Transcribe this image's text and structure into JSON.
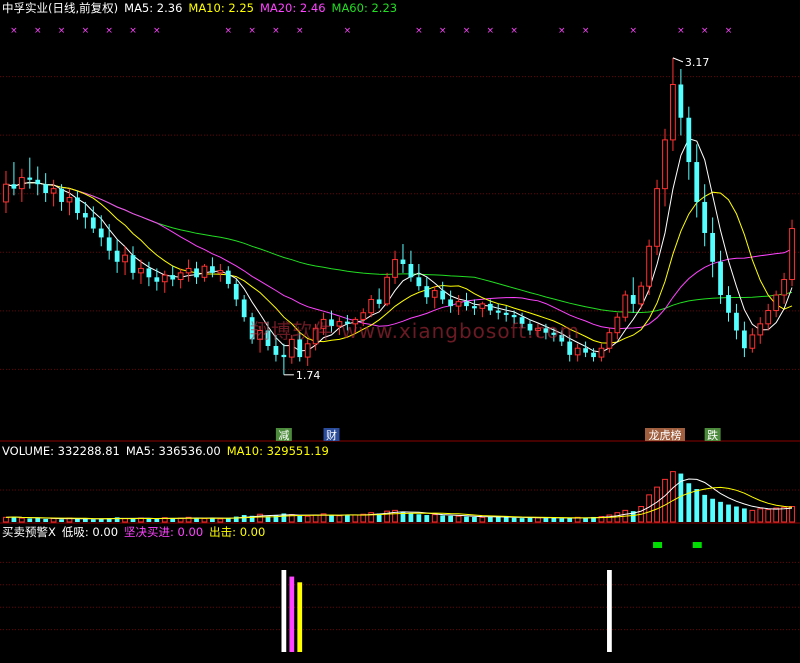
{
  "colors": {
    "up": "#ff3232",
    "down": "#54ffff",
    "ma5": "#ffffff",
    "ma10": "#ffff00",
    "ma20": "#ff44ff",
    "ma60": "#22dd22",
    "text": "#ffffff",
    "grid": "#6e0000",
    "white": "#ffffff",
    "mag": "#ff44ff",
    "yel": "#ffff00",
    "green": "#00dd00"
  },
  "price_header": {
    "name": "中孚实业(日线,前复权)",
    "ma5": "MA5: 2.36",
    "ma10": "MA10: 2.25",
    "ma20": "MA20: 2.46",
    "ma60": "MA60: 2.23"
  },
  "volume_header": {
    "label": "VOLUME: 332288.81",
    "ma5": "MA5: 336536.00",
    "ma10": "MA10: 329551.19"
  },
  "indicator_header": {
    "name": "买卖预警X",
    "low": "低吸: 0.00",
    "buy": "坚决买进: 0.00",
    "out": "出击: 0.00"
  },
  "watermark": "翔博软件 www.xiangbosoft.com",
  "chart_data": [
    {
      "type": "candlestick",
      "title": "中孚实业(日线,前复权)",
      "price_min_label": "1.74",
      "price_max_label": "3.17",
      "ylim": [
        1.5,
        3.35
      ],
      "ohlc": [
        [
          2.52,
          2.66,
          2.47,
          2.6
        ],
        [
          2.6,
          2.7,
          2.55,
          2.58
        ],
        [
          2.58,
          2.67,
          2.52,
          2.63
        ],
        [
          2.63,
          2.72,
          2.58,
          2.62
        ],
        [
          2.62,
          2.68,
          2.55,
          2.6
        ],
        [
          2.6,
          2.65,
          2.52,
          2.56
        ],
        [
          2.56,
          2.62,
          2.5,
          2.58
        ],
        [
          2.58,
          2.6,
          2.48,
          2.52
        ],
        [
          2.52,
          2.58,
          2.46,
          2.54
        ],
        [
          2.54,
          2.57,
          2.44,
          2.47
        ],
        [
          2.47,
          2.52,
          2.4,
          2.45
        ],
        [
          2.45,
          2.5,
          2.38,
          2.4
        ],
        [
          2.4,
          2.46,
          2.32,
          2.36
        ],
        [
          2.36,
          2.42,
          2.26,
          2.3
        ],
        [
          2.3,
          2.35,
          2.2,
          2.25
        ],
        [
          2.25,
          2.32,
          2.19,
          2.28
        ],
        [
          2.28,
          2.32,
          2.17,
          2.2
        ],
        [
          2.2,
          2.26,
          2.15,
          2.22
        ],
        [
          2.22,
          2.25,
          2.14,
          2.18
        ],
        [
          2.18,
          2.22,
          2.12,
          2.16
        ],
        [
          2.16,
          2.21,
          2.11,
          2.19
        ],
        [
          2.19,
          2.23,
          2.14,
          2.17
        ],
        [
          2.17,
          2.22,
          2.13,
          2.2
        ],
        [
          2.2,
          2.26,
          2.16,
          2.22
        ],
        [
          2.22,
          2.25,
          2.15,
          2.18
        ],
        [
          2.18,
          2.24,
          2.16,
          2.23
        ],
        [
          2.23,
          2.27,
          2.18,
          2.2
        ],
        [
          2.2,
          2.24,
          2.16,
          2.21
        ],
        [
          2.21,
          2.23,
          2.13,
          2.15
        ],
        [
          2.15,
          2.17,
          2.05,
          2.08
        ],
        [
          2.08,
          2.1,
          1.98,
          2.0
        ],
        [
          2.0,
          2.02,
          1.88,
          1.9
        ],
        [
          1.9,
          1.96,
          1.84,
          1.94
        ],
        [
          1.94,
          1.98,
          1.85,
          1.87
        ],
        [
          1.87,
          1.92,
          1.8,
          1.83
        ],
        [
          1.83,
          1.88,
          1.74,
          1.82
        ],
        [
          1.82,
          1.92,
          1.79,
          1.9
        ],
        [
          1.9,
          1.93,
          1.8,
          1.82
        ],
        [
          1.82,
          1.9,
          1.78,
          1.88
        ],
        [
          1.88,
          1.97,
          1.85,
          1.95
        ],
        [
          1.95,
          2.02,
          1.92,
          1.99
        ],
        [
          1.99,
          2.03,
          1.93,
          1.96
        ],
        [
          1.96,
          2.0,
          1.92,
          1.98
        ],
        [
          1.98,
          2.01,
          1.94,
          1.97
        ],
        [
          1.97,
          2.0,
          1.93,
          1.99
        ],
        [
          1.99,
          2.04,
          1.96,
          2.02
        ],
        [
          2.02,
          2.1,
          2.0,
          2.08
        ],
        [
          2.08,
          2.13,
          2.04,
          2.06
        ],
        [
          2.06,
          2.2,
          2.05,
          2.18
        ],
        [
          2.18,
          2.3,
          2.15,
          2.26
        ],
        [
          2.26,
          2.33,
          2.2,
          2.24
        ],
        [
          2.24,
          2.3,
          2.16,
          2.18
        ],
        [
          2.18,
          2.24,
          2.12,
          2.14
        ],
        [
          2.14,
          2.18,
          2.06,
          2.09
        ],
        [
          2.09,
          2.14,
          2.04,
          2.12
        ],
        [
          2.12,
          2.16,
          2.06,
          2.08
        ],
        [
          2.08,
          2.12,
          2.02,
          2.05
        ],
        [
          2.05,
          2.1,
          2.01,
          2.07
        ],
        [
          2.07,
          2.11,
          2.03,
          2.05
        ],
        [
          2.05,
          2.08,
          2.01,
          2.04
        ],
        [
          2.04,
          2.07,
          2.0,
          2.06
        ],
        [
          2.06,
          2.08,
          2.01,
          2.03
        ],
        [
          2.03,
          2.06,
          1.99,
          2.02
        ],
        [
          2.02,
          2.05,
          1.98,
          2.01
        ],
        [
          2.01,
          2.03,
          1.97,
          2.0
        ],
        [
          2.0,
          2.02,
          1.95,
          1.97
        ],
        [
          1.97,
          1.99,
          1.92,
          1.94
        ],
        [
          1.94,
          1.97,
          1.91,
          1.95
        ],
        [
          1.95,
          1.97,
          1.9,
          1.93
        ],
        [
          1.93,
          1.95,
          1.89,
          1.92
        ],
        [
          1.92,
          1.94,
          1.87,
          1.89
        ],
        [
          1.89,
          1.92,
          1.8,
          1.83
        ],
        [
          1.83,
          1.88,
          1.8,
          1.86
        ],
        [
          1.86,
          1.89,
          1.82,
          1.84
        ],
        [
          1.84,
          1.86,
          1.8,
          1.82
        ],
        [
          1.82,
          1.88,
          1.8,
          1.86
        ],
        [
          1.86,
          1.95,
          1.84,
          1.93
        ],
        [
          1.93,
          2.02,
          1.9,
          2.0
        ],
        [
          2.0,
          2.12,
          1.98,
          2.1
        ],
        [
          2.1,
          2.18,
          2.02,
          2.06
        ],
        [
          2.06,
          2.16,
          2.04,
          2.14
        ],
        [
          2.14,
          2.35,
          2.1,
          2.32
        ],
        [
          2.32,
          2.62,
          2.28,
          2.58
        ],
        [
          2.58,
          2.85,
          2.5,
          2.8
        ],
        [
          2.8,
          3.17,
          2.75,
          3.05
        ],
        [
          3.05,
          3.12,
          2.82,
          2.9
        ],
        [
          2.9,
          2.95,
          2.62,
          2.7
        ],
        [
          2.7,
          2.78,
          2.45,
          2.52
        ],
        [
          2.52,
          2.6,
          2.32,
          2.38
        ],
        [
          2.38,
          2.45,
          2.18,
          2.25
        ],
        [
          2.25,
          2.3,
          2.06,
          2.1
        ],
        [
          2.1,
          2.14,
          1.98,
          2.02
        ],
        [
          2.02,
          2.06,
          1.9,
          1.94
        ],
        [
          1.94,
          1.98,
          1.82,
          1.86
        ],
        [
          1.86,
          1.95,
          1.84,
          1.92
        ],
        [
          1.92,
          2.0,
          1.88,
          1.97
        ],
        [
          1.97,
          2.06,
          1.94,
          2.03
        ],
        [
          2.03,
          2.12,
          2.0,
          2.1
        ],
        [
          2.1,
          2.2,
          2.06,
          2.17
        ],
        [
          2.17,
          2.44,
          2.14,
          2.4
        ]
      ],
      "bottom_tags": [
        {
          "text": "减",
          "bar": 35,
          "color": "#ffffff",
          "bg": "#4c8a3c"
        },
        {
          "text": "财",
          "bar": 41,
          "color": "#ffffff",
          "bg": "#2a4c9a"
        },
        {
          "text": "龙虎榜",
          "bar": 83,
          "color": "#ffffff",
          "bg": "#a06040"
        },
        {
          "text": "跌",
          "bar": 89,
          "color": "#ffffff",
          "bg": "#4c8a3c"
        }
      ]
    },
    {
      "type": "bar",
      "title": "VOLUME",
      "ylim": [
        0,
        160
      ],
      "values": [
        12,
        14,
        10,
        9,
        11,
        8,
        9,
        7,
        10,
        8,
        9,
        7,
        8,
        10,
        12,
        9,
        8,
        10,
        9,
        8,
        11,
        9,
        10,
        12,
        10,
        9,
        11,
        8,
        10,
        14,
        18,
        16,
        20,
        15,
        17,
        22,
        19,
        16,
        15,
        18,
        21,
        17,
        16,
        19,
        18,
        20,
        24,
        22,
        28,
        30,
        26,
        22,
        20,
        18,
        19,
        17,
        16,
        15,
        14,
        13,
        12,
        14,
        13,
        12,
        11,
        10,
        12,
        11,
        10,
        11,
        9,
        10,
        12,
        11,
        13,
        14,
        18,
        24,
        30,
        28,
        40,
        70,
        90,
        110,
        130,
        125,
        100,
        85,
        70,
        60,
        52,
        45,
        40,
        35,
        30,
        34,
        32,
        36,
        38,
        40
      ]
    },
    {
      "type": "bar",
      "title": "买卖预警X",
      "signals": [
        {
          "bar": 35,
          "series": "低吸",
          "color": "#ffffff",
          "height": 1.0
        },
        {
          "bar": 36,
          "series": "坚决买进",
          "color": "#ff44ff",
          "height": 0.92
        },
        {
          "bar": 37,
          "series": "出击",
          "color": "#ffff00",
          "height": 0.85
        },
        {
          "bar": 76,
          "series": "低吸",
          "color": "#ffffff",
          "height": 1.0
        }
      ],
      "markers": [
        {
          "bar": 82,
          "color": "#00dd00"
        },
        {
          "bar": 87,
          "color": "#00dd00"
        }
      ]
    }
  ]
}
